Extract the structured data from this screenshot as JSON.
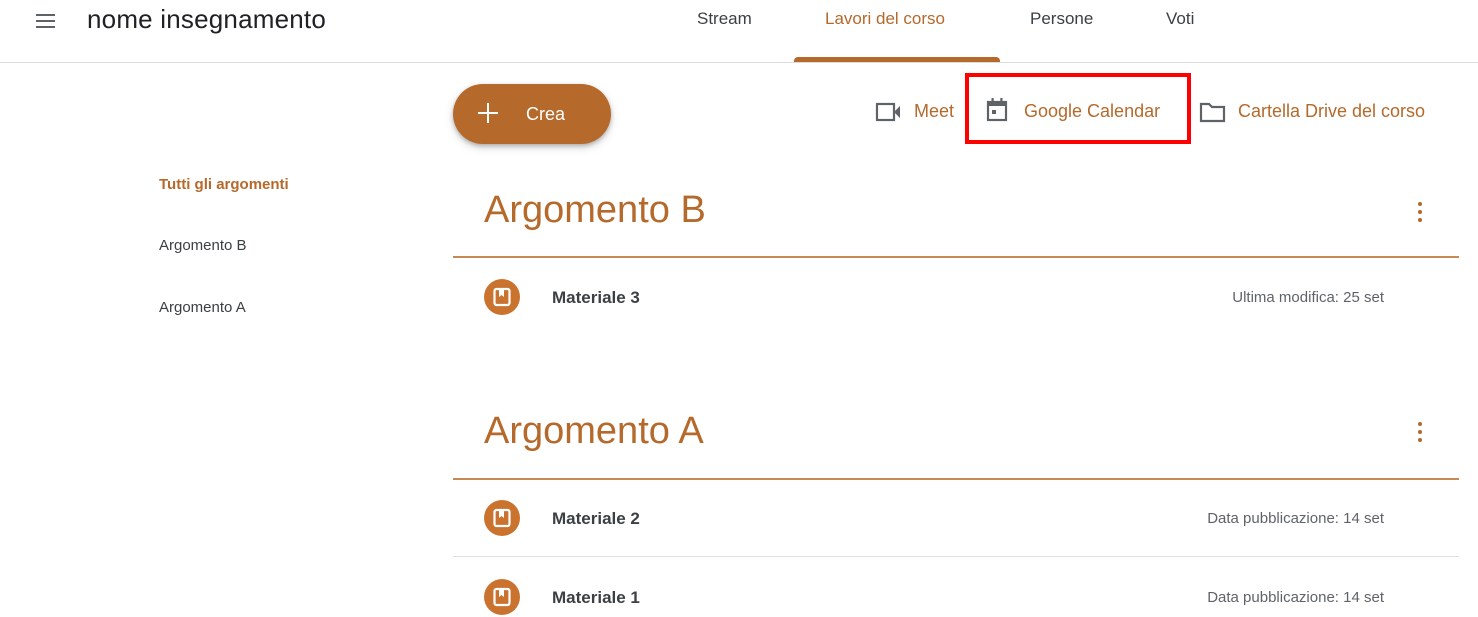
{
  "header": {
    "app_title": "nome insegnamento",
    "tabs": [
      {
        "label": "Stream"
      },
      {
        "label": "Lavori del corso"
      },
      {
        "label": "Persone"
      },
      {
        "label": "Voti"
      }
    ],
    "active_tab": "Lavori del corso"
  },
  "toolbar": {
    "create_label": "Crea",
    "meet_label": "Meet",
    "calendar_label": "Google Calendar",
    "drive_label": "Cartella Drive del corso"
  },
  "sidebar": {
    "items": [
      {
        "label": "Tutti gli argomenti",
        "active": true
      },
      {
        "label": "Argomento B",
        "active": false
      },
      {
        "label": "Argomento A",
        "active": false
      }
    ]
  },
  "sections": [
    {
      "title": "Argomento B",
      "items": [
        {
          "title": "Materiale 3",
          "meta": "Ultima modifica: 25 set"
        }
      ]
    },
    {
      "title": "Argomento A",
      "items": [
        {
          "title": "Materiale 2",
          "meta": "Data pubblicazione: 14 set"
        },
        {
          "title": "Materiale 1",
          "meta": "Data pubblicazione: 14 set"
        }
      ]
    }
  ],
  "colors": {
    "accent": "#b5692b",
    "highlight": "#ff0000"
  },
  "icons": {
    "menu": "hamburger-menu-icon",
    "create": "plus-icon",
    "meet": "video-camera-icon",
    "calendar": "calendar-icon",
    "drive": "folder-icon",
    "material": "book-icon",
    "more": "more-vertical-icon"
  }
}
